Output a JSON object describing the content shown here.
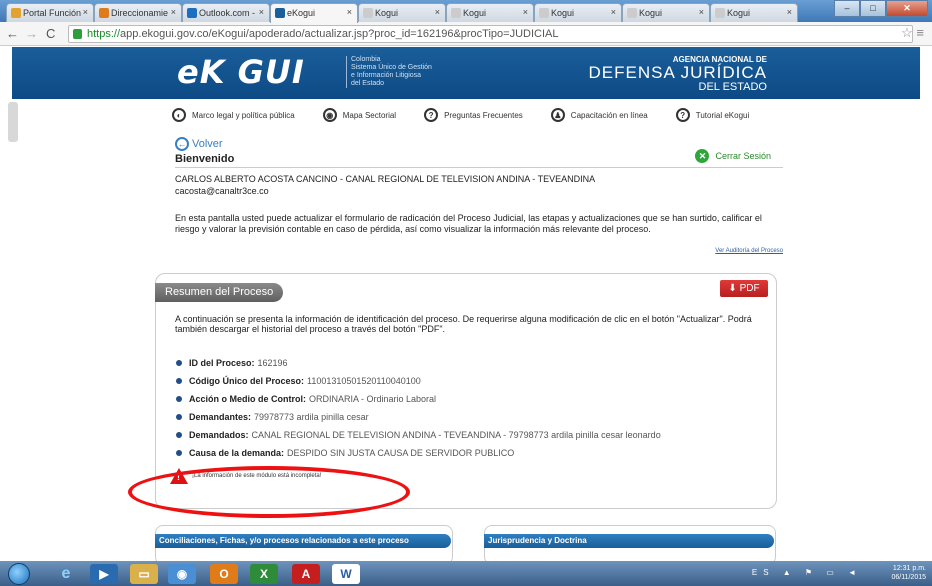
{
  "browser": {
    "tabs": [
      {
        "label": "Portal Función",
        "color": "#e3a12d",
        "active": false
      },
      {
        "label": "Direccionamie",
        "color": "#e07b1a",
        "active": false
      },
      {
        "label": "Outlook.com -",
        "color": "#1b6fc2",
        "active": false
      },
      {
        "label": "eKogui",
        "color": "#1a5e9a",
        "active": true
      },
      {
        "label": "Kogui",
        "color": "#cccccc",
        "active": false
      },
      {
        "label": "Kogui",
        "color": "#cccccc",
        "active": false
      },
      {
        "label": "Kogui",
        "color": "#cccccc",
        "active": false
      },
      {
        "label": "Kogui",
        "color": "#cccccc",
        "active": false
      },
      {
        "label": "Kogui",
        "color": "#cccccc",
        "active": false
      }
    ],
    "url_scheme": "https://",
    "url_rest": "app.ekogui.gov.co/eKogui/apoderado/actualizar.jsp?proc_id=162196&procTipo=JUDICIAL"
  },
  "header": {
    "logo": "eK GUI",
    "logo_sub_lines": [
      "Colombia",
      "Sistema Único de Gestión",
      "e Información Litigiosa",
      "del Estado"
    ],
    "agency_line1": "AGENCIA NACIONAL DE",
    "agency_line2": "DEFENSA JURÍDICA",
    "agency_line3": "DEL ESTADO"
  },
  "nav": [
    {
      "label": "Marco legal y política pública",
      "icon": "compass-icon"
    },
    {
      "label": "Mapa Sectorial",
      "icon": "map-icon"
    },
    {
      "label": "Preguntas Frecuentes",
      "icon": "question-icon"
    },
    {
      "label": "Capacitación en línea",
      "icon": "person-icon"
    },
    {
      "label": "Tutorial eKogui",
      "icon": "help-icon"
    }
  ],
  "page": {
    "volver": "Volver",
    "bienvenido": "Bienvenido",
    "cerrar_sesion": "Cerrar Sesión",
    "user_name": "CARLOS ALBERTO ACOSTA CANCINO - CANAL REGIONAL DE TELEVISION ANDINA - TEVEANDINA",
    "user_email": "cacosta@canaltr3ce.co",
    "intro": "En esta pantalla usted puede actualizar el formulario de radicación del Proceso Judicial, las etapas y actualizaciones que se han surtido, calificar el riesgo y valorar la previsión contable en caso de pérdida, así como visualizar la información más relevante del proceso.",
    "ver_auditoria": "Ver Auditoría del Proceso"
  },
  "resumen": {
    "tab_label": "Resumen del Proceso",
    "pdf_label": "PDF",
    "intro": "A continuación se presenta la información de identificación del proceso. De requerirse alguna modificación de clic en el botón \"Actualizar\". Podrá también descargar el historial del proceso a través del botón \"PDF\".",
    "fields": [
      {
        "label": "ID del Proceso:",
        "value": "162196"
      },
      {
        "label": "Código Único del Proceso:",
        "value": "11001310501520110040100"
      },
      {
        "label": "Acción o Medio de Control:",
        "value": "ORDINARIA - Ordinario Laboral"
      },
      {
        "label": "Demandantes:",
        "value": "79978773 ardila pinilla cesar"
      },
      {
        "label": "Demandados:",
        "value": "CANAL REGIONAL DE TELEVISION ANDINA - TEVEANDINA - 79798773 ardila pinilla cesar leonardo"
      },
      {
        "label": "Causa de la demanda:",
        "value": "DESPIDO SIN JUSTA CAUSA DE SERVIDOR PUBLICO"
      }
    ],
    "warning": "¡La información de este módulo está incompleta!"
  },
  "subpanels": {
    "left_title": "Conciliaciones, Fichas, y/o procesos relacionados a este proceso",
    "right_title": "Jurisprudencia y Doctrina"
  },
  "taskbar": {
    "lang": "ES",
    "time": "12:31 p.m.",
    "date": "06/11/2015"
  }
}
